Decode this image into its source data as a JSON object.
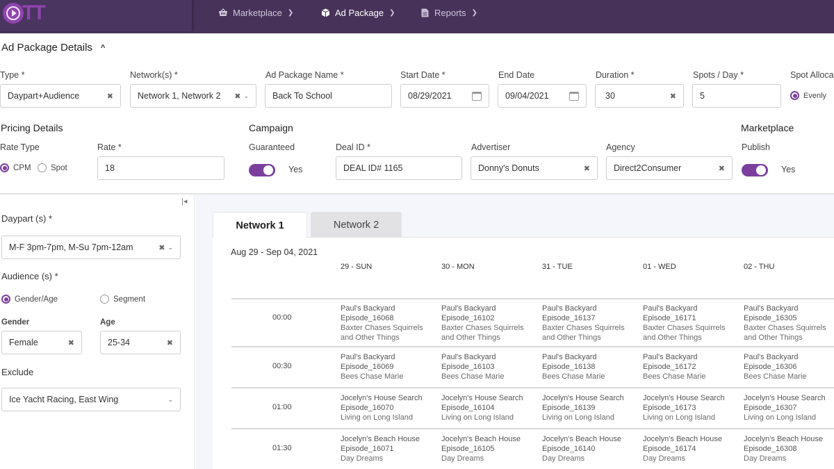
{
  "app": {
    "logo_text": "TT"
  },
  "nav": [
    {
      "label": "Marketplace",
      "icon": "basket-icon",
      "active": false
    },
    {
      "label": "Ad Package",
      "icon": "cube-icon",
      "active": true
    },
    {
      "label": "Reports",
      "icon": "document-icon",
      "active": false
    }
  ],
  "details": {
    "title": "Ad Package Details",
    "type": {
      "label": "Type *",
      "value": "Daypart+Audience"
    },
    "networks": {
      "label": "Network(s) *",
      "value": "Network 1, Network 2"
    },
    "name": {
      "label": "Ad Package Name *",
      "value": "Back To School"
    },
    "start_date": {
      "label": "Start Date *",
      "value": "08/29/2021"
    },
    "end_date": {
      "label": "End Date",
      "value": "09/04/2021"
    },
    "duration": {
      "label": "Duration *",
      "value": "30"
    },
    "spots": {
      "label": "Spots / Day *",
      "value": "5"
    },
    "allocation": {
      "label": "Spot Alloca",
      "option": "Evenly"
    }
  },
  "pricing": {
    "title": "Pricing Details",
    "rate_type_label": "Rate Type",
    "rate_options": [
      "CPM",
      "Spot"
    ],
    "rate_label": "Rate *",
    "rate_value": "18"
  },
  "campaign": {
    "title": "Campaign",
    "guaranteed_label": "Guaranteed",
    "guaranteed_value": "Yes",
    "deal_label": "Deal ID *",
    "deal_value": "DEAL ID# 1165",
    "advertiser_label": "Advertiser",
    "advertiser_value": "Donny's Donuts",
    "agency_label": "Agency",
    "agency_value": "Direct2Consumer"
  },
  "marketplace": {
    "title": "Marketplace",
    "publish_label": "Publish",
    "publish_value": "Yes"
  },
  "filters": {
    "daypart_label": "Daypart (s) *",
    "daypart_value": "M-F 3pm-7pm, M-Su 7pm-12am",
    "audience_label": "Audience (s) *",
    "audience_options": [
      "Gender/Age",
      "Segment"
    ],
    "gender_label": "Gender",
    "gender_value": "Female",
    "age_label": "Age",
    "age_value": "25-34",
    "exclude_label": "Exclude",
    "exclude_value": "Ice Yacht Racing, East Wing"
  },
  "schedule": {
    "tabs": [
      "Network 1",
      "Network 2"
    ],
    "range": "Aug 29 - Sep 04, 2021",
    "days": [
      "29 - SUN",
      "30 - MON",
      "31 - TUE",
      "01 - WED",
      "02 - THU"
    ],
    "rows": [
      {
        "time": "00:00",
        "cells": [
          [
            "Paul's Backyard",
            "Episode_16068",
            "Baxter Chases Squirrels",
            "and Other Things"
          ],
          [
            "Paul's Backyard",
            "Episode_16102",
            "Baxter Chases Squirrels",
            "and Other Things"
          ],
          [
            "Paul's Backyard",
            "Episode_16137",
            "Baxter Chases Squirrels",
            "and Other Things"
          ],
          [
            "Paul's Backyard",
            "Episode_16171",
            "Baxter Chases Squirrels",
            "and Other Things"
          ],
          [
            "Paul's Backyard",
            "Episode_16305",
            "Baxter Chases Squirrels",
            "and Other Things"
          ]
        ]
      },
      {
        "time": "00:30",
        "cells": [
          [
            "Paul's Backyard",
            "Episode_16069",
            "Bees Chase Marie"
          ],
          [
            "Paul's Backyard",
            "Episode_16103",
            "Bees Chase Marie"
          ],
          [
            "Paul's Backyard",
            "Episode_16138",
            "Bees Chase Marie"
          ],
          [
            "Paul's Backyard",
            "Episode_16172",
            "Bees Chase Marie"
          ],
          [
            "Paul's Backyard",
            "Episode_16306",
            "Bees Chase Marie"
          ]
        ]
      },
      {
        "time": "01:00",
        "cells": [
          [
            "Jocelyn's House Search",
            "Episode_16070",
            "Living on Long Island"
          ],
          [
            "Jocelyn's House Search",
            "Episode_16104",
            "Living on Long Island"
          ],
          [
            "Jocelyn's House Search",
            "Episode_16139",
            "Living on Long Island"
          ],
          [
            "Jocelyn's House Search",
            "Episode_16173",
            "Living on Long Island"
          ],
          [
            "Jocelyn's House Search",
            "Episode_16307",
            "Living on Long Island"
          ]
        ]
      },
      {
        "time": "01:30",
        "cells": [
          [
            "Jocelyn's Beach House",
            "Episode_16071",
            "Day Dreams"
          ],
          [
            "Jocelyn's Beach House",
            "Episode_16105",
            "Day Dreams"
          ],
          [
            "Jocelyn's Beach House",
            "Episode_16140",
            "Day Dreams"
          ],
          [
            "Jocelyn's Beach House",
            "Episode_16174",
            "Day Dreams"
          ],
          [
            "Jocelyn's Beach House",
            "Episode_16308",
            "Day Dreams"
          ]
        ]
      }
    ]
  },
  "colors": {
    "brand": "#47325a",
    "accent": "#7b3f9e"
  }
}
